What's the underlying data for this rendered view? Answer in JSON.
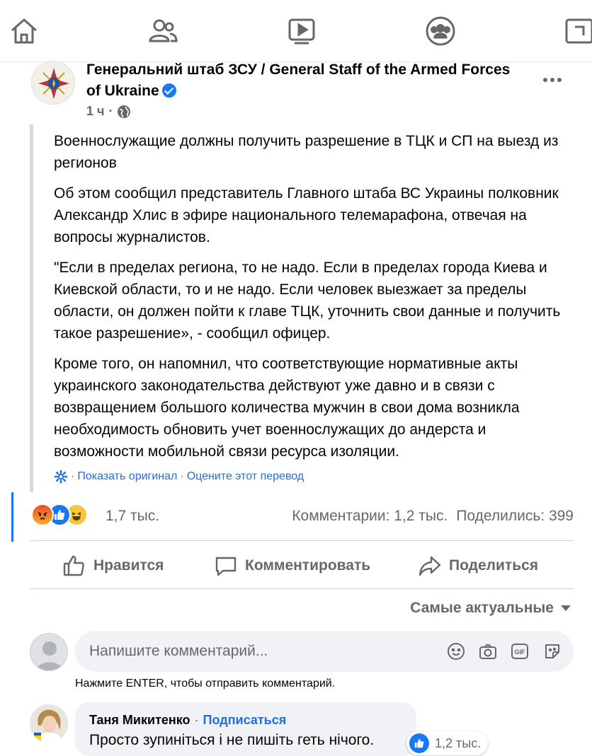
{
  "nav": {
    "items": [
      {
        "icon": "home-icon"
      },
      {
        "icon": "friends-icon"
      },
      {
        "icon": "watch-icon"
      },
      {
        "icon": "groups-icon"
      },
      {
        "icon": "gaming-icon"
      }
    ]
  },
  "post": {
    "page_name": "Генеральний штаб ЗСУ / General Staff of the Armed Forces of Ukraine",
    "time": "1 ч",
    "paragraphs": [
      "Военнослужащие должны получить разрешение в ТЦК и СП на выезд из регионов",
      "Об этом сообщил представитель Главного штаба ВС Украины полковник Александр Хлис в эфире национального телемарафона, отвечая на вопросы журналистов.",
      "\"Если в пределах региона, то не надо. Если в пределах города Киева и Киевской области, то и не надо. Если человек выезжает за пределы области, он должен пойти к главе ТЦК, уточнить свои данные и получить такое разрешение», - сообщил офицер.",
      "Кроме того, он напомнил, что соответствующие нормативные акты украинского законодательства действуют уже давно и в связи с возвращением большого количества мужчин в свои дома возникла необходимость обновить учет военнослужащих до андерста и возможности мобильной связи ресурса изоляции."
    ],
    "translate": {
      "sep1": "·",
      "show_original": "Показать оригинал",
      "sep2": "·",
      "rate": "Оцените этот перевод"
    },
    "reactions": [
      "angry",
      "like",
      "haha"
    ],
    "reaction_count": "1,7 тыс.",
    "comments_count": "Комментарии: 1,2 тыс.",
    "shares_count": "Поделились: 399"
  },
  "actions": {
    "like": "Нравится",
    "comment": "Комментировать",
    "share": "Поделиться"
  },
  "sort_label": "Самые актуальные",
  "composer": {
    "placeholder": "Напишите комментарий...",
    "hint": "Нажмите ENTER, чтобы отправить комментарий."
  },
  "comment": {
    "author": "Таня Микитенко",
    "sep": "·",
    "follow": "Подписаться",
    "text": "Просто зупиніться і не пишіть геть нічого.",
    "likes": "1,2 тыс."
  },
  "colors": {
    "accent": "#1877f2",
    "link": "#216fdb",
    "secondary_text": "#65676b",
    "bubble": "#f0f2f5"
  }
}
